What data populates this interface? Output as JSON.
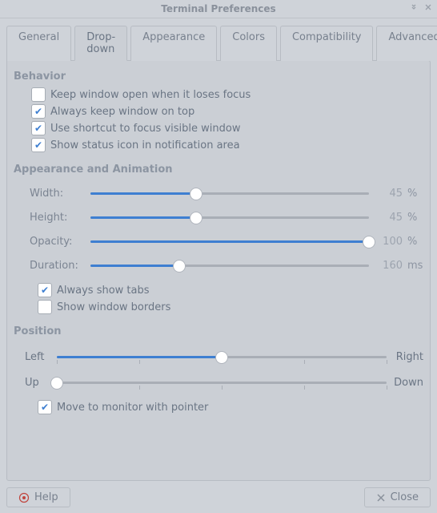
{
  "window": {
    "title": "Terminal Preferences"
  },
  "tabs": [
    "General",
    "Drop-down",
    "Appearance",
    "Colors",
    "Compatibility",
    "Advanced"
  ],
  "active_tab": 1,
  "sections": {
    "behavior": {
      "title": "Behavior",
      "items": [
        {
          "label": "Keep window open when it loses focus",
          "checked": false
        },
        {
          "label": "Always keep window on top",
          "checked": true
        },
        {
          "label": "Use shortcut to focus visible window",
          "checked": true
        },
        {
          "label": "Show status icon in notification area",
          "checked": true
        }
      ]
    },
    "appearance": {
      "title": "Appearance and Animation",
      "sliders": {
        "width": {
          "label": "Width:",
          "value": 45,
          "max": 100,
          "fill_pct": 38,
          "unit": "%"
        },
        "height": {
          "label": "Height:",
          "value": 45,
          "max": 100,
          "fill_pct": 38,
          "unit": "%"
        },
        "opacity": {
          "label": "Opacity:",
          "value": 100,
          "max": 100,
          "fill_pct": 100,
          "unit": "%"
        },
        "duration": {
          "label": "Duration:",
          "value": 160,
          "max": 500,
          "fill_pct": 32,
          "unit": "ms"
        }
      },
      "checks": [
        {
          "label": "Always show tabs",
          "checked": true
        },
        {
          "label": "Show window borders",
          "checked": false
        }
      ]
    },
    "position": {
      "title": "Position",
      "hslider": {
        "left_label": "Left",
        "right_label": "Right",
        "fill_pct": 50
      },
      "vslider": {
        "left_label": "Up",
        "right_label": "Down",
        "fill_pct": 0
      },
      "move_to_monitor": {
        "label": "Move to monitor with pointer",
        "checked": true
      }
    }
  },
  "buttons": {
    "help": "Help",
    "close": "Close"
  }
}
